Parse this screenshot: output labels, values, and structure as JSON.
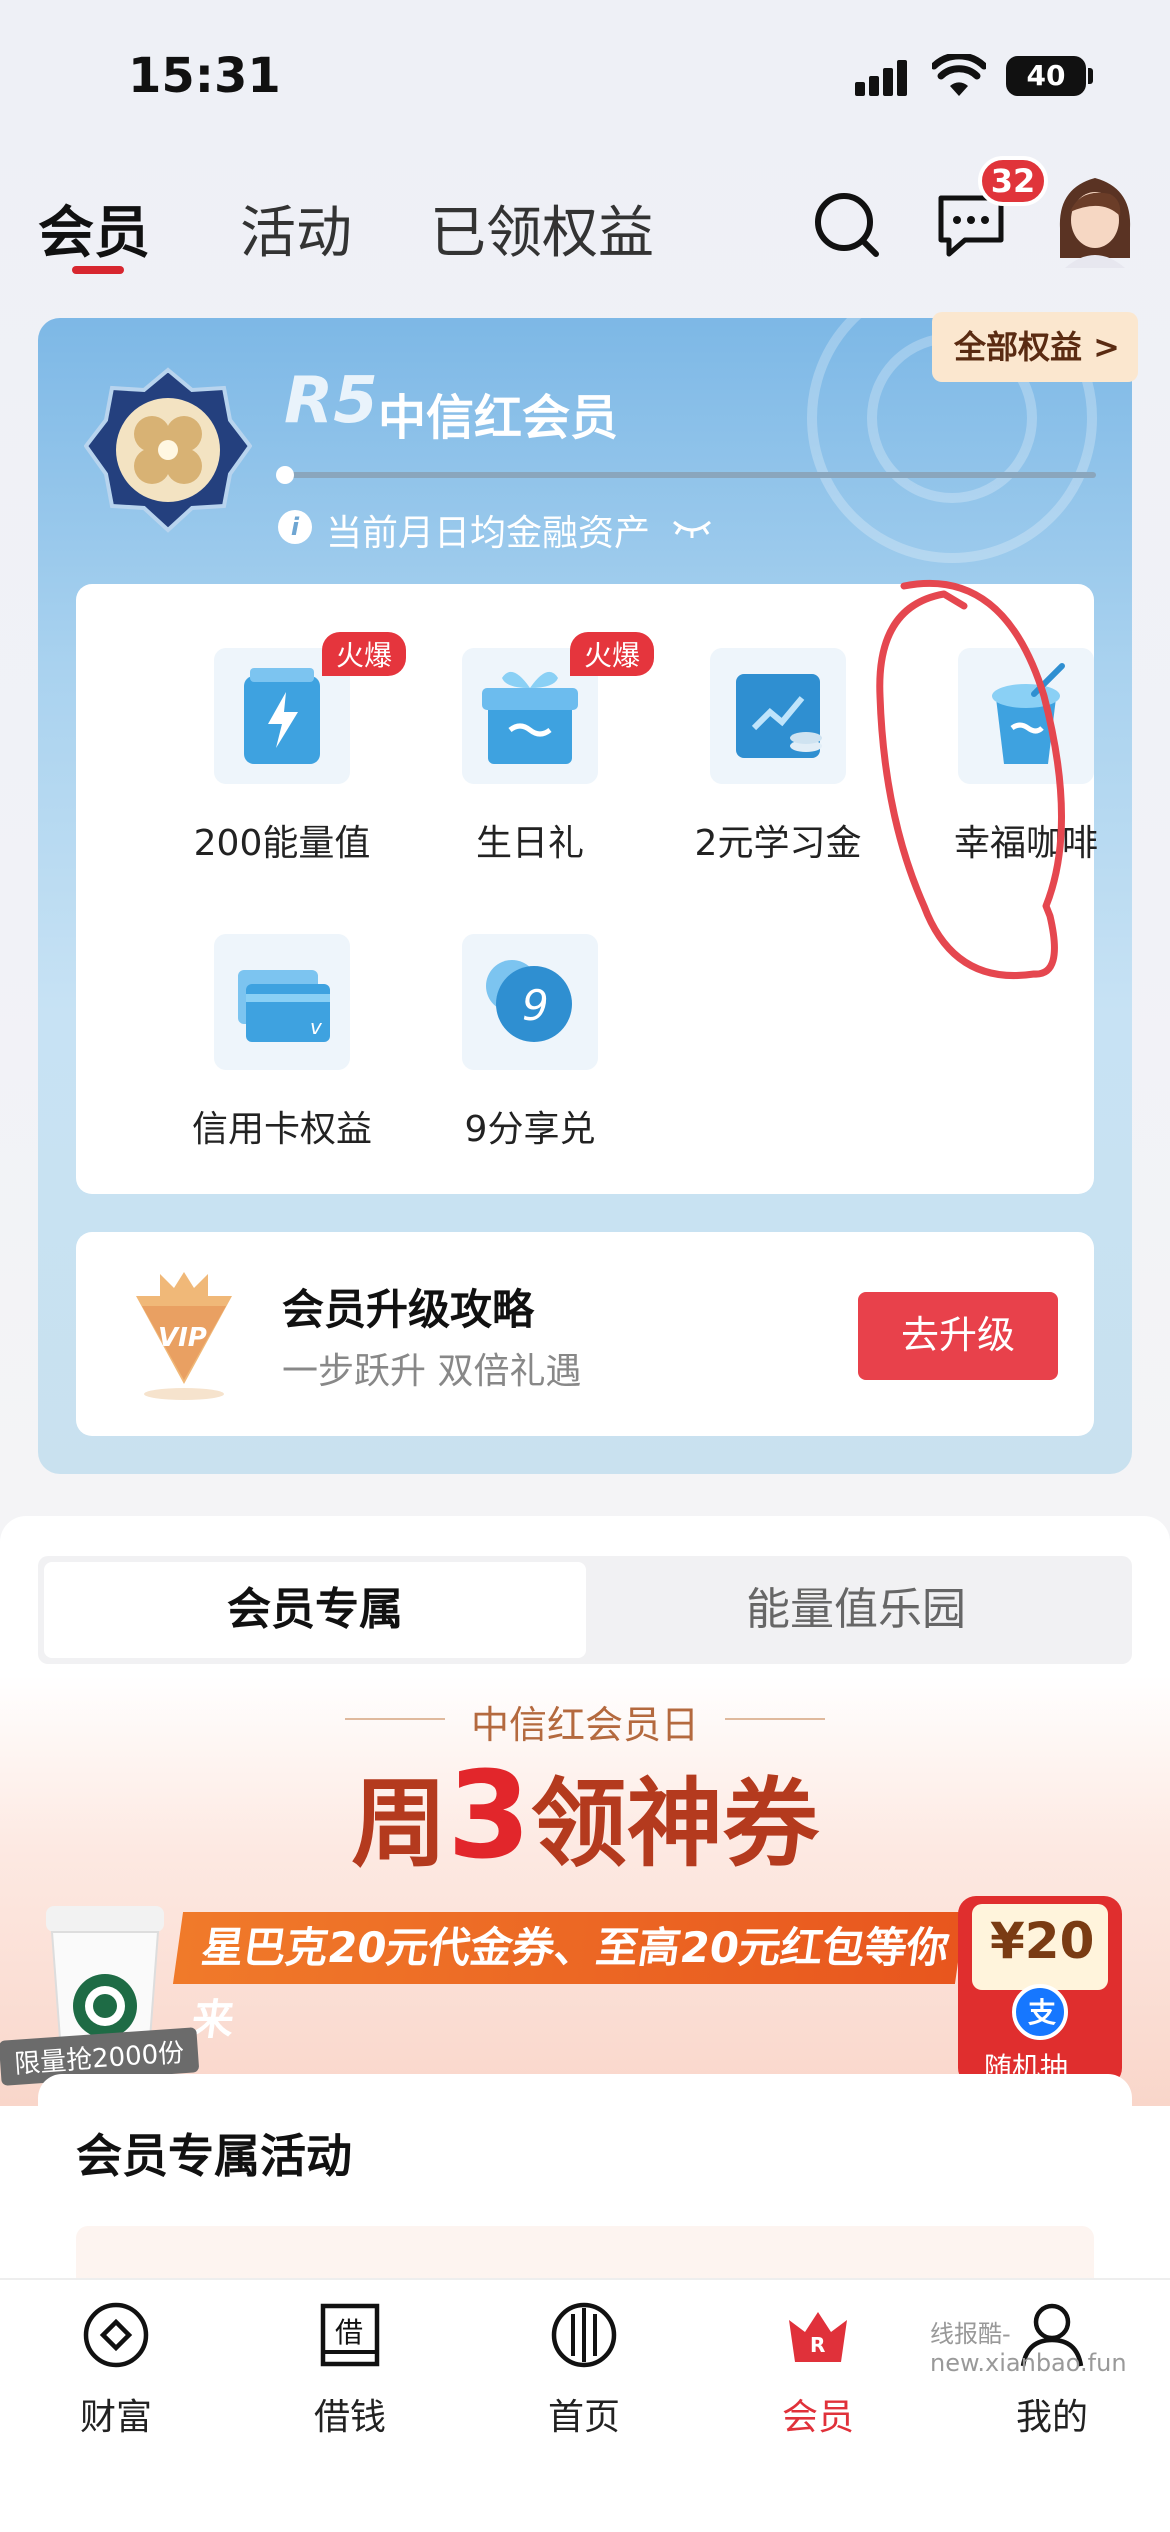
{
  "status_bar": {
    "time": "15:31",
    "battery": "40"
  },
  "top_nav": {
    "tabs": [
      "会员",
      "活动",
      "已领权益"
    ],
    "message_count": "32"
  },
  "member_card": {
    "all_rights_label": "全部权益 >",
    "level": "R5",
    "level_name": "中信红会员",
    "progress": 0,
    "asset_label": "当前月日均金融资产",
    "rights": [
      {
        "label": "200能量值",
        "tag": "火爆",
        "icon": "energy-bottle-icon"
      },
      {
        "label": "生日礼",
        "tag": "火爆",
        "icon": "gift-box-icon"
      },
      {
        "label": "2元学习金",
        "tag": "",
        "icon": "study-book-icon"
      },
      {
        "label": "幸福咖啡",
        "tag": "",
        "icon": "coffee-cup-icon"
      },
      {
        "label": "信用卡权益",
        "tag": "",
        "icon": "credit-card-icon"
      },
      {
        "label": "9分享兑",
        "tag": "",
        "icon": "coin-9-icon"
      }
    ],
    "upgrade": {
      "title": "会员升级攻略",
      "subtitle": "一步跃升 双倍礼遇",
      "button": "去升级"
    }
  },
  "lower": {
    "segments": [
      "会员专属",
      "能量值乐园"
    ],
    "banner": {
      "subtitle": "中信红会员日",
      "title_prefix": "周",
      "title_number": "3",
      "title_suffix": "领神券",
      "ribbon": "星巴克20元代金券、至高20元红包等你来",
      "limit_tag": "限量抢2000份",
      "redpack_amount": "¥20",
      "redpack_label": "随机抽"
    },
    "activity_title": "会员专属活动"
  },
  "tabbar": {
    "items": [
      "财富",
      "借钱",
      "首页",
      "会员",
      "我的"
    ],
    "active_index": 3
  },
  "watermark": "线报酷-new.xianbao.fun",
  "colors": {
    "accent": "#e0313a",
    "card_blue": "#7db8e6",
    "upgrade_btn": "#e8414b"
  }
}
